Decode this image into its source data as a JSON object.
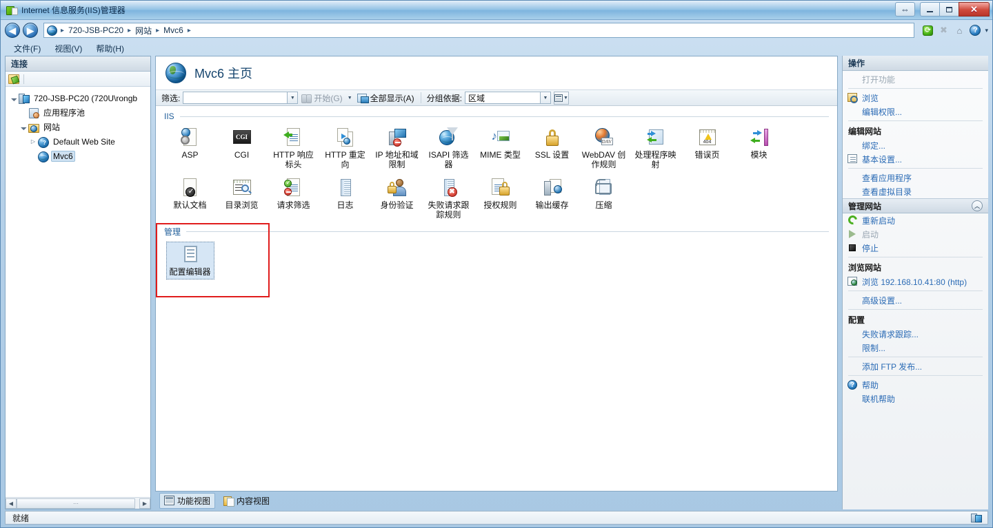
{
  "window": {
    "title": "Internet 信息服务(IIS)管理器",
    "icon": "iis-app-icon",
    "controls": {
      "restore_all": "⇔",
      "minimize": "minimize",
      "maximize": "maximize",
      "close": "close"
    }
  },
  "address_bar": {
    "back": "◀",
    "forward": "▶",
    "crumbs": [
      "720-JSB-PC20",
      "网站",
      "Mvc6"
    ],
    "separator": "▸",
    "tools": {
      "refresh": "refresh-icon",
      "stop": "stop-icon",
      "home": "home-icon",
      "help": "help-icon",
      "help_caret": "▾"
    }
  },
  "menubar": {
    "items": [
      "文件(F)",
      "视图(V)",
      "帮助(H)"
    ]
  },
  "connections": {
    "header": "连接",
    "toolbar": {
      "connect_icon": "connect-to-server-icon"
    },
    "tree": [
      {
        "label": "720-JSB-PC20 (720U\\rongb",
        "icon": "server-icon",
        "twist": "expanded",
        "depth": 0,
        "selected": false
      },
      {
        "label": "应用程序池",
        "icon": "app-pool-icon",
        "twist": "none",
        "depth": 1,
        "selected": false
      },
      {
        "label": "网站",
        "icon": "sites-folder-icon",
        "twist": "expanded",
        "depth": 1,
        "selected": false
      },
      {
        "label": "Default Web Site",
        "icon": "site-globe-question-icon",
        "twist": "collapsed",
        "depth": 2,
        "selected": false
      },
      {
        "label": "Mvc6",
        "icon": "site-globe-icon",
        "twist": "none",
        "depth": 2,
        "selected": true
      }
    ],
    "scroll_thumb_glyph": "⋯"
  },
  "page": {
    "icon": "site-globe-icon",
    "title": "Mvc6 主页"
  },
  "filter_bar": {
    "filter_label": "筛选:",
    "filter_value": "",
    "filter_dropdown": "▾",
    "go_label": "开始(G)",
    "go_dropdown": "▾",
    "show_all_label": "全部显示(A)",
    "group_by_label": "分组依据:",
    "group_by_value": "区域",
    "group_by_dropdown": "▾",
    "view_mode_dropdown": "▾"
  },
  "groups": [
    {
      "name": "IIS",
      "tiles": [
        {
          "label": "ASP",
          "icon": "asp-icon",
          "selected": false
        },
        {
          "label": "CGI",
          "icon": "cgi-icon",
          "selected": false
        },
        {
          "label": "HTTP 响应标头",
          "icon": "http-response-headers-icon",
          "selected": false
        },
        {
          "label": "HTTP 重定向",
          "icon": "http-redirect-icon",
          "selected": false
        },
        {
          "label": "IP 地址和域限制",
          "icon": "ip-address-restrictions-icon",
          "selected": false
        },
        {
          "label": "ISAPI 筛选器",
          "icon": "isapi-filters-icon",
          "selected": false
        },
        {
          "label": "MIME 类型",
          "icon": "mime-types-icon",
          "selected": false
        },
        {
          "label": "SSL 设置",
          "icon": "ssl-settings-icon",
          "selected": false
        },
        {
          "label": "WebDAV 创作规则",
          "icon": "webdav-authoring-rules-icon",
          "selected": false
        },
        {
          "label": "处理程序映射",
          "icon": "handler-mappings-icon",
          "selected": false
        },
        {
          "label": "错误页",
          "icon": "error-pages-icon",
          "selected": false
        },
        {
          "label": "模块",
          "icon": "modules-icon",
          "selected": false
        },
        {
          "label": "默认文档",
          "icon": "default-document-icon",
          "selected": false
        },
        {
          "label": "目录浏览",
          "icon": "directory-browsing-icon",
          "selected": false
        },
        {
          "label": "请求筛选",
          "icon": "request-filtering-icon",
          "selected": false
        },
        {
          "label": "日志",
          "icon": "logging-icon",
          "selected": false
        },
        {
          "label": "身份验证",
          "icon": "authentication-icon",
          "selected": false
        },
        {
          "label": "失败请求跟踪规则",
          "icon": "failed-request-tracing-icon",
          "selected": false
        },
        {
          "label": "授权规则",
          "icon": "authorization-rules-icon",
          "selected": false
        },
        {
          "label": "输出缓存",
          "icon": "output-caching-icon",
          "selected": false
        },
        {
          "label": "压缩",
          "icon": "compression-icon",
          "selected": false
        }
      ]
    },
    {
      "name": "管理",
      "tiles": [
        {
          "label": "配置编辑器",
          "icon": "configuration-editor-icon",
          "selected": true
        }
      ]
    }
  ],
  "annotation": {
    "color": "#e01b1b"
  },
  "view_tabs": [
    {
      "label": "功能视图",
      "icon": "features-view-icon",
      "active": true
    },
    {
      "label": "内容视图",
      "icon": "content-view-icon",
      "active": false
    }
  ],
  "actions": {
    "header": "操作",
    "items": [
      {
        "label": "打开功能",
        "type": "link",
        "state": "disabled",
        "icon": null
      },
      {
        "divider": true
      },
      {
        "label": "浏览",
        "type": "link",
        "state": "enabled",
        "icon": "browse-folder-icon"
      },
      {
        "label": "编辑权限...",
        "type": "link",
        "state": "enabled",
        "icon": null
      },
      {
        "divider": true
      },
      {
        "label": "编辑网站",
        "type": "heading",
        "state": "enabled",
        "icon": null
      },
      {
        "label": "绑定...",
        "type": "link",
        "state": "enabled",
        "icon": null
      },
      {
        "label": "基本设置...",
        "type": "link",
        "state": "enabled",
        "icon": "basic-settings-icon"
      },
      {
        "divider": true
      },
      {
        "label": "查看应用程序",
        "type": "link",
        "state": "enabled",
        "icon": null
      },
      {
        "label": "查看虚拟目录",
        "type": "link",
        "state": "enabled",
        "icon": null
      },
      {
        "label": "管理网站",
        "type": "banner",
        "state": "enabled",
        "icon": null,
        "collapse": "⌃"
      },
      {
        "label": "重新启动",
        "type": "link",
        "state": "enabled",
        "icon": "restart-icon"
      },
      {
        "label": "启动",
        "type": "link",
        "state": "disabled",
        "icon": "start-icon"
      },
      {
        "label": "停止",
        "type": "link",
        "state": "enabled",
        "icon": "stop-square-icon"
      },
      {
        "divider": true
      },
      {
        "label": "浏览网站",
        "type": "heading",
        "state": "enabled",
        "icon": null
      },
      {
        "label": "浏览 192.168.10.41:80 (http)",
        "type": "link",
        "state": "enabled",
        "icon": "browse-site-icon"
      },
      {
        "divider": true
      },
      {
        "label": "高级设置...",
        "type": "link",
        "state": "enabled",
        "icon": null
      },
      {
        "divider": true
      },
      {
        "label": "配置",
        "type": "heading",
        "state": "enabled",
        "icon": null
      },
      {
        "label": "失败请求跟踪...",
        "type": "link",
        "state": "enabled",
        "icon": null
      },
      {
        "label": "限制...",
        "type": "link",
        "state": "enabled",
        "icon": null
      },
      {
        "divider": true
      },
      {
        "label": "添加 FTP 发布...",
        "type": "link",
        "state": "enabled",
        "icon": null
      },
      {
        "divider": true
      },
      {
        "label": "帮助",
        "type": "link",
        "state": "enabled",
        "icon": "help-circle-icon"
      },
      {
        "label": "联机帮助",
        "type": "link",
        "state": "enabled",
        "icon": null
      }
    ]
  },
  "status_bar": {
    "text": "就绪",
    "icon": "server-status-icon"
  }
}
